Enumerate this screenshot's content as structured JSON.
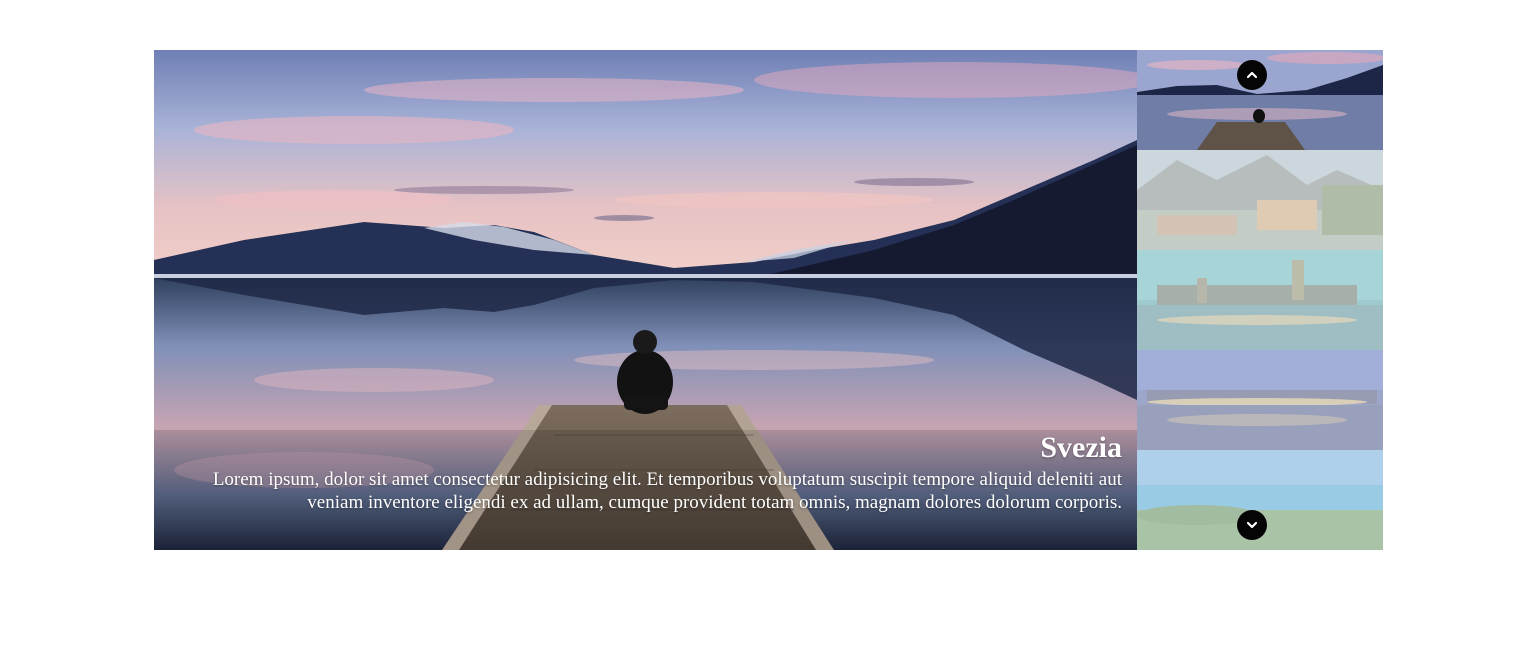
{
  "slide": {
    "title": "Svezia",
    "description": "Lorem ipsum, dolor sit amet consectetur adipisicing elit. Et temporibus voluptatum suscipit tempore aliquid deleniti aut veniam inventore eligendi ex ad ullam, cumque provident totam omnis, magnam dolores dolorum corporis."
  },
  "thumbnails": {
    "active_index": 0,
    "count": 5
  },
  "navigation": {
    "up_icon": "chevron-up-icon",
    "down_icon": "chevron-down-icon"
  },
  "colors": {
    "nav_button": "#050505",
    "caption_text": "#ffffff",
    "inactive_veil": "rgba(255,255,255,0.55)"
  }
}
